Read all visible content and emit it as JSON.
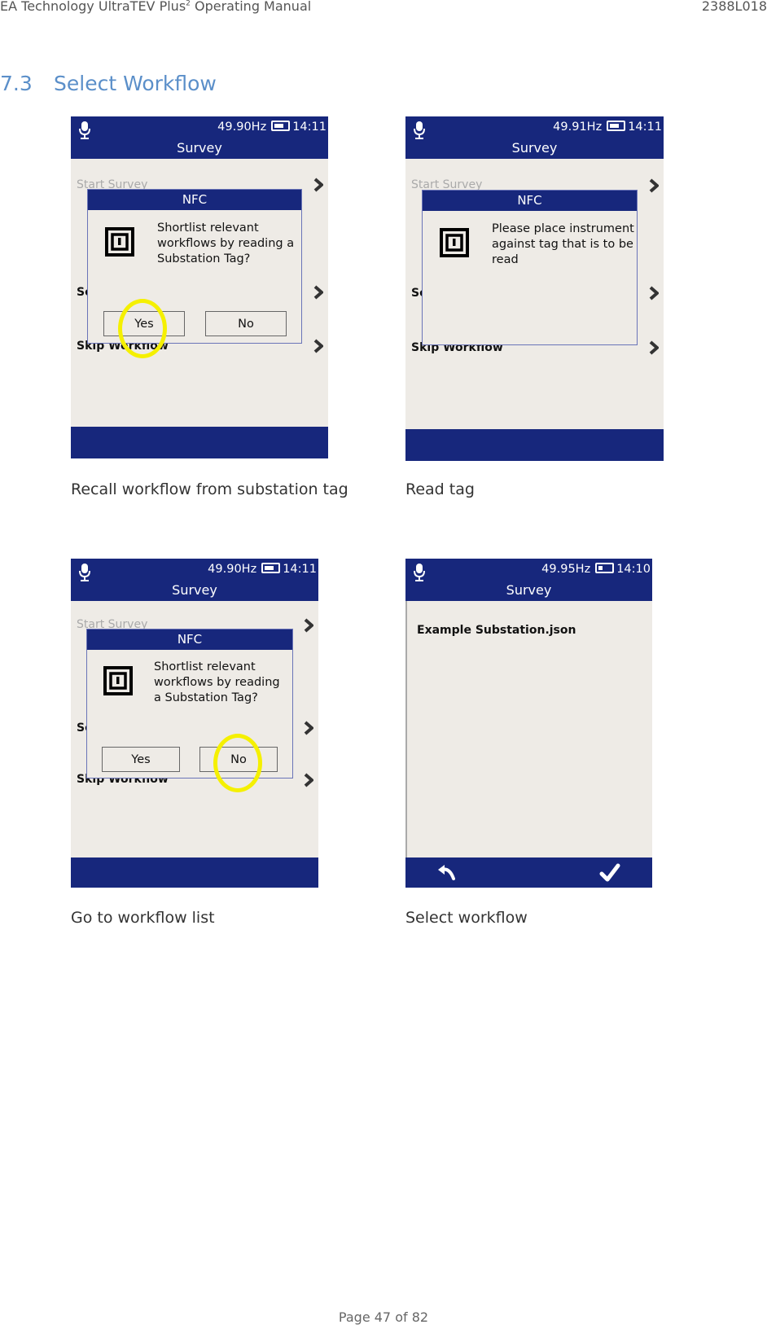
{
  "document": {
    "header_left": "EA Technology UltraTEV Plus",
    "header_left_sup": "2",
    "header_left_suffix": " Operating Manual",
    "header_right": "2388L018",
    "section_number": "7.3",
    "section_title": "Select Workflow",
    "footer": "Page 47 of 82"
  },
  "colors": {
    "bar_blue": "#17277c",
    "screen_bg": "#eeebe6",
    "highlight": "#f5f000",
    "heading_blue": "#5b8fc9"
  },
  "screens": [
    {
      "caption": "Recall workflow from substation tag",
      "frequency": "49.90Hz",
      "time": "14:11",
      "title": "Survey",
      "menu": [
        "Start Survey",
        "Se",
        "Skip Workflow"
      ],
      "dialog": {
        "title": "NFC",
        "icon": "nfc-tag-icon",
        "message": "Shortlist relevant workflows by reading a Substation Tag?",
        "buttons": [
          "Yes",
          "No"
        ],
        "highlighted_button": "Yes"
      }
    },
    {
      "caption": "Read tag",
      "frequency": "49.91Hz",
      "time": "14:11",
      "title": "Survey",
      "menu": [
        "Start Survey",
        "Se",
        "Skip Workflow"
      ],
      "dialog": {
        "title": "NFC",
        "icon": "nfc-tag-icon",
        "message": "Please place instrument against tag that is to be read"
      }
    },
    {
      "caption": "Go to workflow list",
      "frequency": "49.90Hz",
      "time": "14:11",
      "title": "Survey",
      "menu": [
        "Start Survey",
        "Se",
        "Skip Workflow"
      ],
      "dialog": {
        "title": "NFC",
        "icon": "nfc-tag-icon",
        "message": "Shortlist relevant workflows by reading a Substation Tag?",
        "buttons": [
          "Yes",
          "No"
        ],
        "highlighted_button": "No"
      }
    },
    {
      "caption": "Select workflow",
      "frequency": "49.95Hz",
      "time": "14:10",
      "title": "Survey",
      "list": [
        "Example Substation.json"
      ],
      "bottom_icons": [
        "back-arrow-icon",
        "checkmark-icon"
      ]
    }
  ]
}
